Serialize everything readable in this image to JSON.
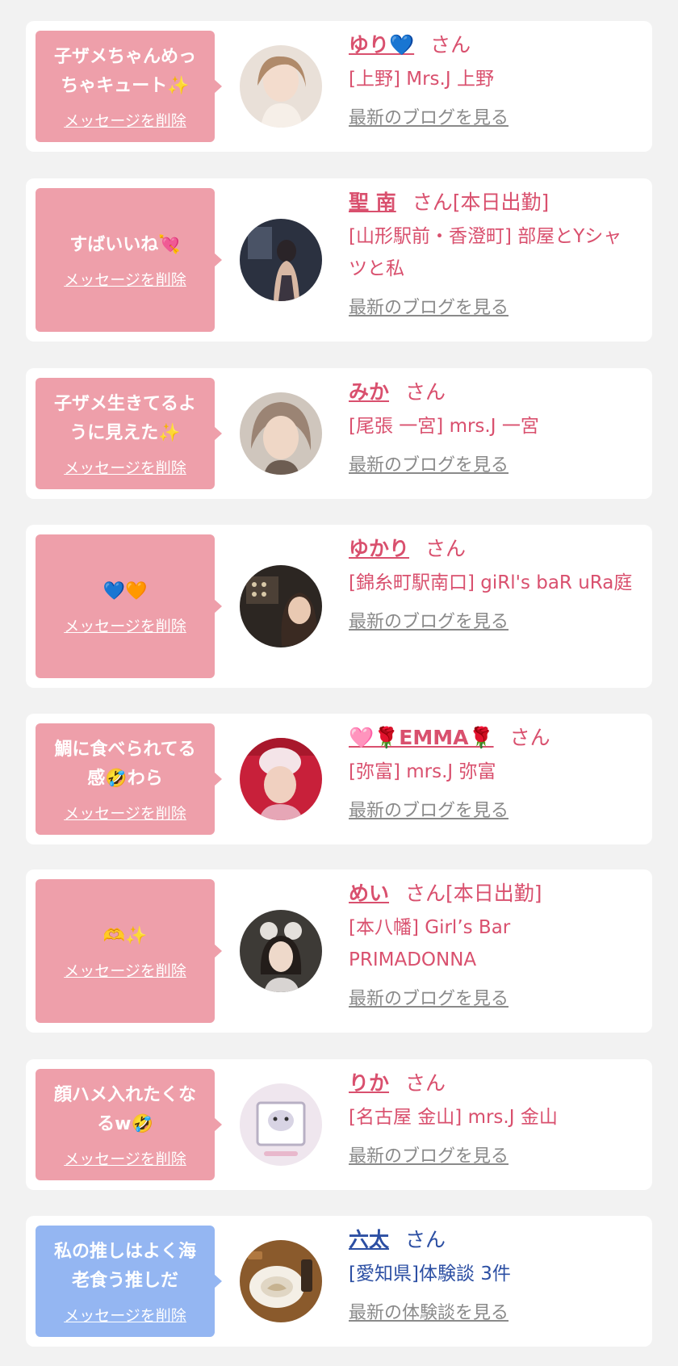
{
  "colors": {
    "pink_bubble": "#ee9faa",
    "blue_bubble": "#94b6f2",
    "pink_text": "#d9506e",
    "blue_text": "#2c4fa3",
    "link_gray": "#8a8a8a",
    "background": "#f2f2f2"
  },
  "delete_label": "メッセージを削除",
  "san_label": "さん",
  "cards": [
    {
      "message": "子ザメちゃんめっ\nちゃキュート✨",
      "name": "ゆり💙",
      "suffix": "",
      "shop": "[上野] Mrs.J 上野",
      "link": "最新のブログを見る"
    },
    {
      "message": "すばいいね💘",
      "name": "聖 南",
      "suffix": "[本日出勤]",
      "shop": "[山形駅前・香澄町] 部屋とYシャツと私",
      "link": "最新のブログを見る"
    },
    {
      "message": "子ザメ生きてるよ\nうに見えた✨",
      "name": "みか",
      "suffix": "",
      "shop": "[尾張 一宮] mrs.J 一宮",
      "link": "最新のブログを見る"
    },
    {
      "message": "💙🧡",
      "name": "ゆかり",
      "suffix": "",
      "shop": "[錦糸町駅南口] giRl's baR uRa庭",
      "link": "最新のブログを見る"
    },
    {
      "message": "鯛に食べられてる\n感🤣わら",
      "name": "🩷🌹EMMA🌹",
      "suffix": "",
      "shop": "[弥富] mrs.J 弥富",
      "link": "最新のブログを見る"
    },
    {
      "message": "🫶✨",
      "name": "めい",
      "suffix": "[本日出勤]",
      "shop": "[本八幡] Girl’s Bar PRIMADONNA",
      "link": "最新のブログを見る"
    },
    {
      "message": "顔ハメ入れたくな\nるw🤣",
      "name": "りか",
      "suffix": "",
      "shop": "[名古屋 金山] mrs.J 金山",
      "link": "最新のブログを見る"
    },
    {
      "message": "私の推しはよく海\n老食う推しだ",
      "name": "六太",
      "suffix": "",
      "shop": "[愛知県]体験談 3件",
      "link": "最新の体験談を見る"
    }
  ]
}
